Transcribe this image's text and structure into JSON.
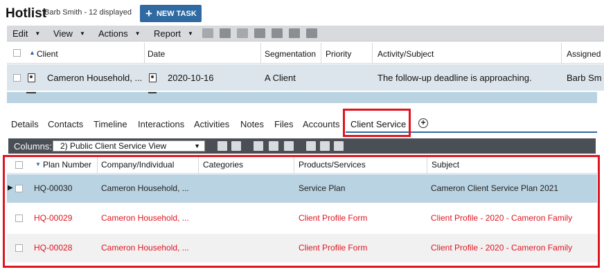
{
  "header": {
    "title": "Hotlist",
    "subtitle": "Barb Smith - 12 displayed",
    "new_task_label": "NEW TASK"
  },
  "toolbar": {
    "menus": [
      "Edit",
      "View",
      "Actions",
      "Report"
    ]
  },
  "top_grid": {
    "columns": [
      "Client",
      "Date",
      "Segmentation",
      "Priority",
      "Activity/Subject",
      "Assigned"
    ],
    "row": {
      "client": "Cameron Household, ...",
      "date": "2020-10-16",
      "segmentation": "A Client",
      "priority": "",
      "activity": "The follow-up deadline is approaching.",
      "assigned": "Barb Sm"
    }
  },
  "tabs": [
    "Details",
    "Contacts",
    "Timeline",
    "Interactions",
    "Activities",
    "Notes",
    "Files",
    "Accounts",
    "Client Service"
  ],
  "active_tab": "Client Service",
  "sub_toolbar": {
    "columns_label": "Columns:",
    "view": "2) Public Client Service View"
  },
  "service_grid": {
    "columns": [
      "Plan Number",
      "Company/Individual",
      "Categories",
      "Products/Services",
      "Subject"
    ],
    "rows": [
      {
        "plan": "HQ-00030",
        "company": "Cameron Household, ...",
        "categories": "",
        "products": "Service Plan",
        "subject": "Cameron Client Service Plan 2021"
      },
      {
        "plan": "HQ-00029",
        "company": "Cameron Household, ...",
        "categories": "",
        "products": "Client Profile Form",
        "subject": "Client Profile - 2020 - Cameron Family"
      },
      {
        "plan": "HQ-00028",
        "company": "Cameron Household, ...",
        "categories": "",
        "products": "Client Profile Form",
        "subject": "Client Profile - 2020 - Cameron Family"
      }
    ]
  },
  "colors": {
    "accent": "#2f6aa3",
    "highlight": "#e0141e",
    "selected_row": "#b9d3e2"
  }
}
